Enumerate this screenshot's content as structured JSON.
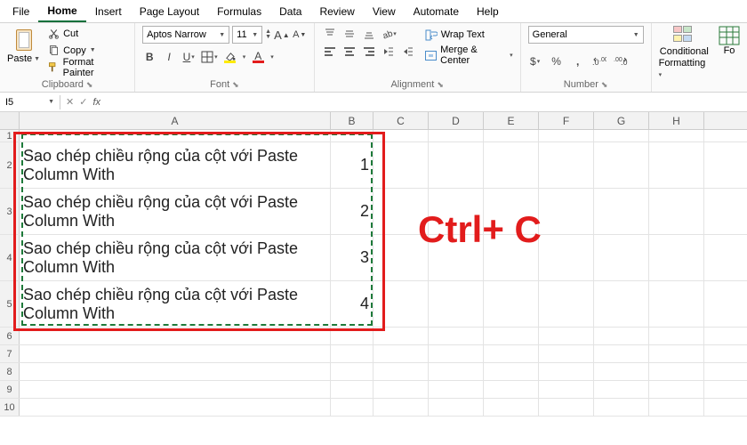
{
  "menubar": [
    "File",
    "Home",
    "Insert",
    "Page Layout",
    "Formulas",
    "Data",
    "Review",
    "View",
    "Automate",
    "Help"
  ],
  "menubar_active": 1,
  "clipboard": {
    "paste": "Paste",
    "cut": "Cut",
    "copy": "Copy",
    "format_painter": "Format Painter",
    "group_label": "Clipboard"
  },
  "font": {
    "name": "Aptos Narrow",
    "size": "11",
    "group_label": "Font"
  },
  "alignment": {
    "wrap": "Wrap Text",
    "merge": "Merge & Center",
    "group_label": "Alignment"
  },
  "number": {
    "format": "General",
    "group_label": "Number"
  },
  "styles": {
    "cf": "Conditional",
    "cf2": "Formatting",
    "fmt": "Fo"
  },
  "namebox": {
    "ref": "I5"
  },
  "columns": [
    "A",
    "B",
    "C",
    "D",
    "E",
    "F",
    "G",
    "H"
  ],
  "rows": {
    "r2": {
      "a": "Sao chép chiều rộng của cột với Paste Column With",
      "b": "1"
    },
    "r3": {
      "a": "Sao chép chiều rộng của cột với Paste Column With",
      "b": "2"
    },
    "r4": {
      "a": "Sao chép chiều rộng của cột với Paste Column With",
      "b": "3"
    },
    "r5": {
      "a": "Sao chép chiều rộng của cột với Paste Column With",
      "b": "4"
    }
  },
  "overlay": {
    "text": "Ctrl+ C"
  }
}
